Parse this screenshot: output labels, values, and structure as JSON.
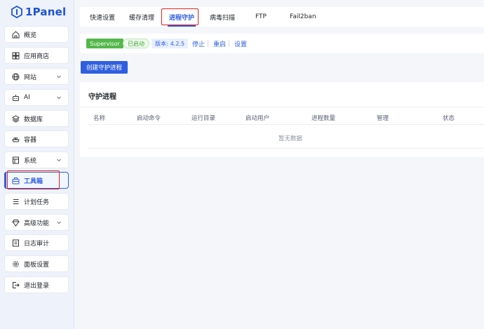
{
  "brand": {
    "name": "1Panel",
    "color": "#1e54d6"
  },
  "sidebar": {
    "items": [
      {
        "label": "概览",
        "icon": "home-icon"
      },
      {
        "label": "应用商店",
        "icon": "grid-icon"
      },
      {
        "label": "网站",
        "icon": "globe-icon",
        "expandable": true
      },
      {
        "label": "AI",
        "icon": "robot-icon",
        "expandable": true
      },
      {
        "label": "数据库",
        "icon": "database-icon"
      },
      {
        "label": "容器",
        "icon": "container-icon"
      },
      {
        "label": "系统",
        "icon": "system-icon",
        "expandable": true
      },
      {
        "label": "工具箱",
        "icon": "toolbox-icon",
        "active": true
      },
      {
        "label": "计划任务",
        "icon": "task-list-icon"
      },
      {
        "label": "高级功能",
        "icon": "diamond-icon",
        "expandable": true
      },
      {
        "label": "日志审计",
        "icon": "log-icon"
      },
      {
        "label": "面板设置",
        "icon": "gear-icon"
      },
      {
        "label": "退出登录",
        "icon": "logout-icon"
      }
    ]
  },
  "tabs": [
    {
      "label": "快速设置"
    },
    {
      "label": "缓存清理"
    },
    {
      "label": "进程守护",
      "active": true
    },
    {
      "label": "病毒扫描"
    },
    {
      "label": "FTP"
    },
    {
      "label": "Fail2ban"
    }
  ],
  "status": {
    "service": "Supervisor",
    "state": "已启动",
    "version_label": "版本:",
    "version": "4.2.5",
    "actions": {
      "stop": "停止",
      "restart": "重启",
      "settings": "设置"
    }
  },
  "create_button": "创建守护进程",
  "card": {
    "title": "守护进程",
    "columns": [
      "名称",
      "启动命令",
      "运行目录",
      "启动用户",
      "进程数量",
      "管理",
      "状态"
    ],
    "empty_text": "暂无数据"
  },
  "colors": {
    "accent": "#2f5fe0",
    "success": "#52b84a",
    "highlight": "#e0201f"
  }
}
